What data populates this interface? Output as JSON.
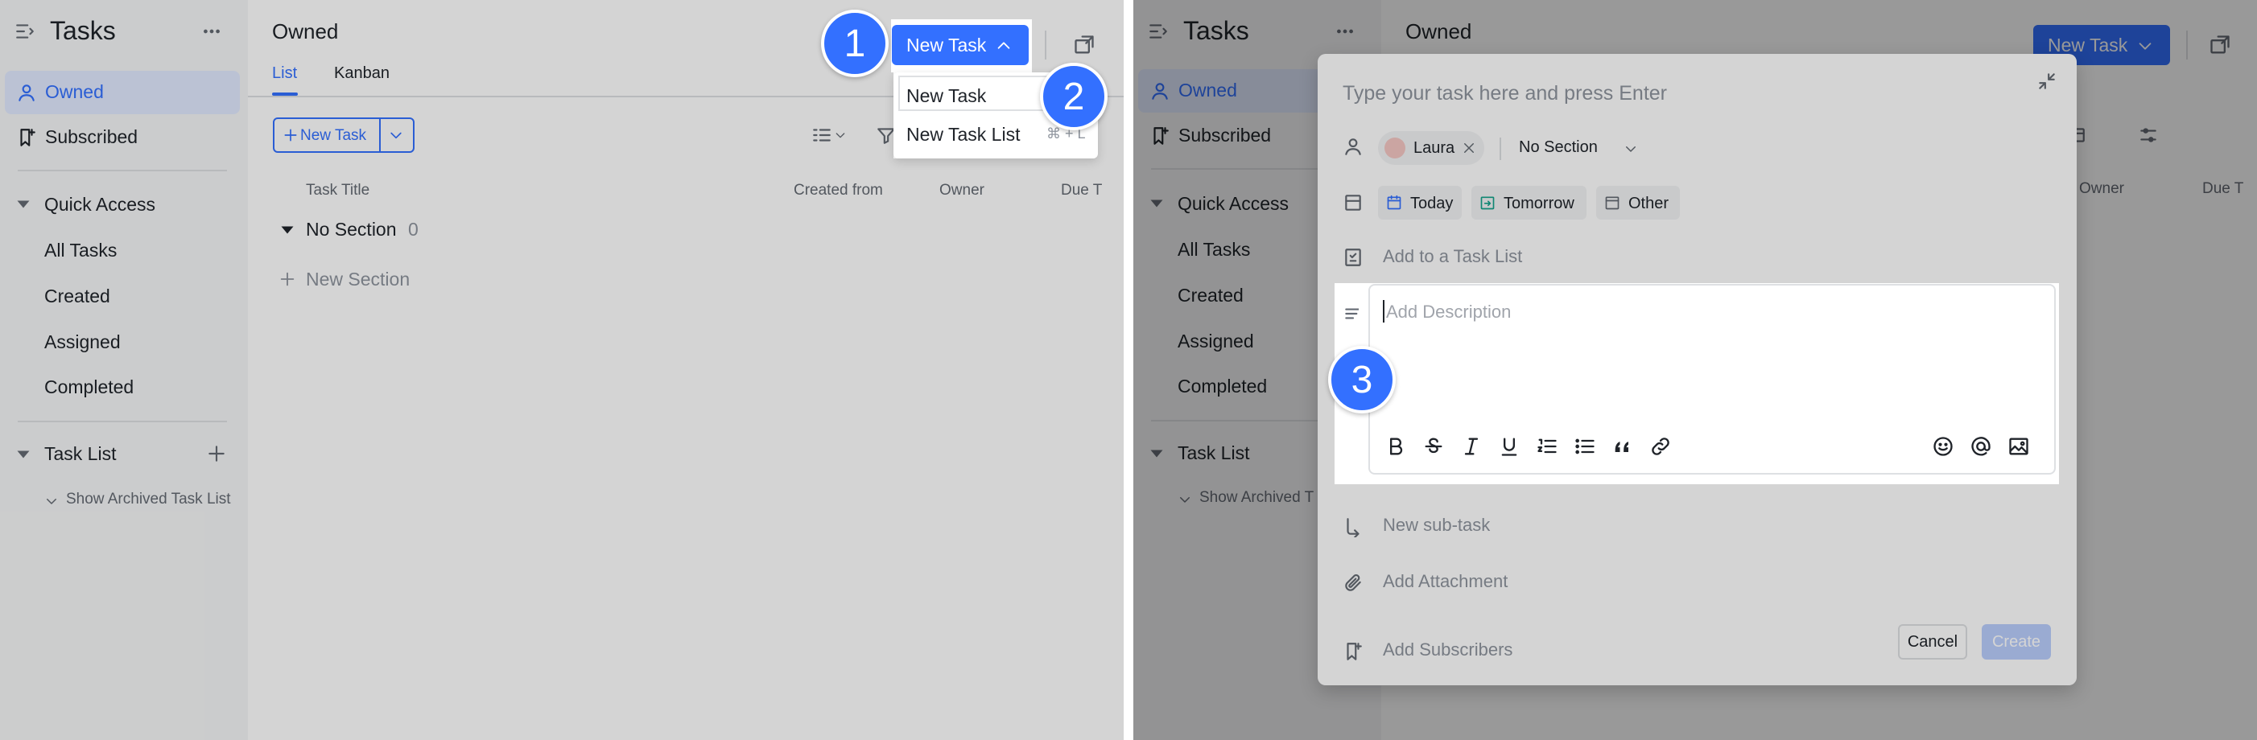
{
  "colors": {
    "accent": "#3370ff",
    "sidebar_bg": "#f5f6f7",
    "selected_bg": "#e1eaff"
  },
  "left": {
    "app_title": "Tasks",
    "nav": {
      "owned": "Owned",
      "subscribed": "Subscribed"
    },
    "quick_access": {
      "label": "Quick Access",
      "items": [
        "All Tasks",
        "Created",
        "Assigned",
        "Completed"
      ]
    },
    "task_list": {
      "label": "Task List",
      "archived": "Show Archived Task List"
    },
    "page_title": "Owned",
    "tabs": [
      "List",
      "Kanban"
    ],
    "new_task_button": "New Task",
    "new_task_small": "New Task",
    "dropdown": {
      "item1": "New Task",
      "item2": "New Task List",
      "shortcut2": "⌘ + L"
    },
    "columns": [
      "Task Title",
      "Created from",
      "Owner",
      "Due T"
    ],
    "section": {
      "name": "No Section",
      "count": "0"
    },
    "new_section": "New Section",
    "badges": [
      "1",
      "2"
    ]
  },
  "right": {
    "app_title": "Tasks",
    "nav": {
      "owned": "Owned",
      "subscribed": "Subscribed"
    },
    "quick_access": {
      "label": "Quick Access",
      "items": [
        "All Tasks",
        "Created",
        "Assigned",
        "Completed"
      ]
    },
    "task_list": {
      "label": "Task List",
      "archived": "Show Archived T"
    },
    "page_title": "Owned",
    "new_task_button": "New Task",
    "columns": [
      "Owner",
      "Due T"
    ],
    "modal": {
      "title_placeholder": "Type your task here and press Enter",
      "assignee": "Laura",
      "section": "No Section",
      "dates": [
        "Today",
        "Tomorrow",
        "Other"
      ],
      "add_task_list": "Add to a Task List",
      "description_placeholder": "Add Description",
      "subtask": "New sub-task",
      "attachment": "Add Attachment",
      "subscribers": "Add Subscribers",
      "cancel": "Cancel",
      "create": "Create"
    },
    "badge": "3"
  }
}
